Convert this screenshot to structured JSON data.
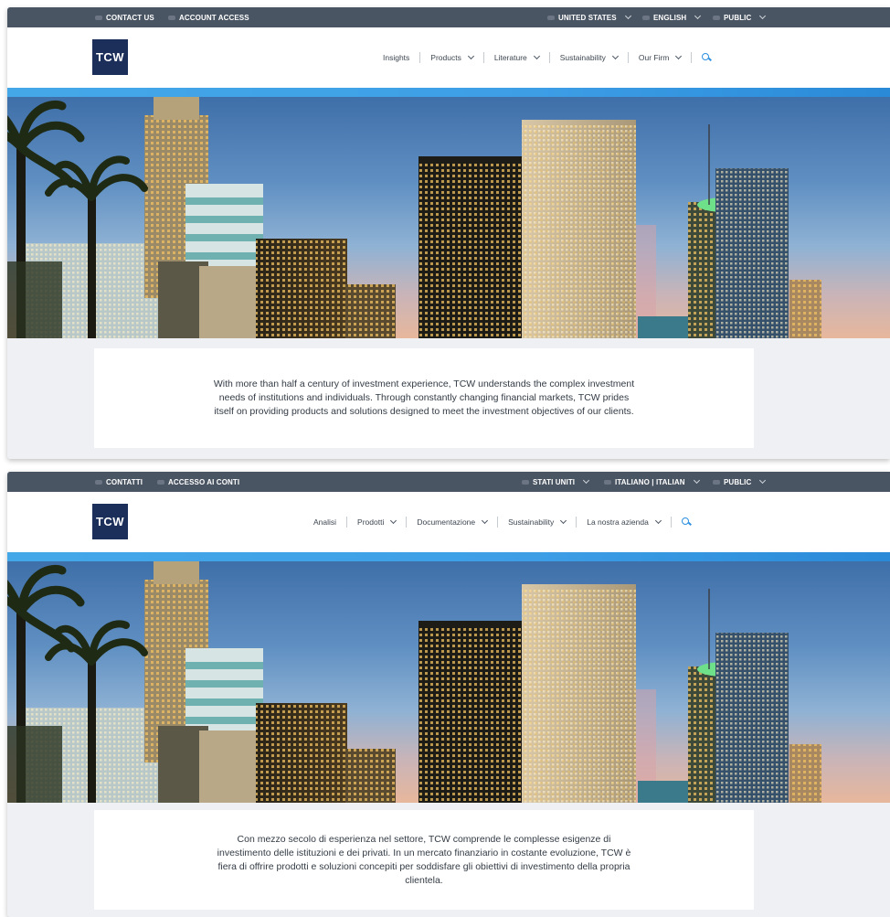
{
  "panels": [
    {
      "lang": "en",
      "utility": {
        "contact": "CONTACT US",
        "account": "ACCOUNT ACCESS",
        "region": "UNITED STATES",
        "language": "ENGLISH",
        "audience": "PUBLIC"
      },
      "logo": "TCW",
      "nav": [
        "Insights",
        "Products",
        "Literature",
        "Sustainability",
        "Our Firm"
      ],
      "intro": "With more than half a century of investment experience, TCW understands the complex investment needs of institutions and individuals. Through constantly changing financial markets, TCW prides itself on providing products and solutions designed to meet the investment objectives of our clients."
    },
    {
      "lang": "it",
      "utility": {
        "contact": "CONTATTI",
        "account": "ACCESSO AI CONTI",
        "region": "STATI UNITI",
        "language": "ITALIANO | ITALIAN",
        "audience": "PUBLIC"
      },
      "logo": "TCW",
      "nav": [
        "Analisi",
        "Prodotti",
        "Documentazione",
        "Sustainability",
        "La nostra azienda"
      ],
      "intro": "Con mezzo secolo di esperienza nel settore, TCW comprende le complesse esigenze di investimento delle istituzioni e dei privati. In un mercato finanziario in costante evoluzione, TCW è fiera di offrire prodotti e soluzioni concepiti per soddisfare gli obiettivi di investimento della propria clientela."
    }
  ],
  "icons": {
    "search": "search-icon",
    "chevron": "chevron-down-icon",
    "utility_bullet": "bullet-icon"
  },
  "colors": {
    "utility_bar": "#4a5563",
    "logo": "#1b2f5a",
    "accent": "#3d9ee6",
    "search": "#2d8fe0",
    "page_bg": "#eef0f3"
  }
}
